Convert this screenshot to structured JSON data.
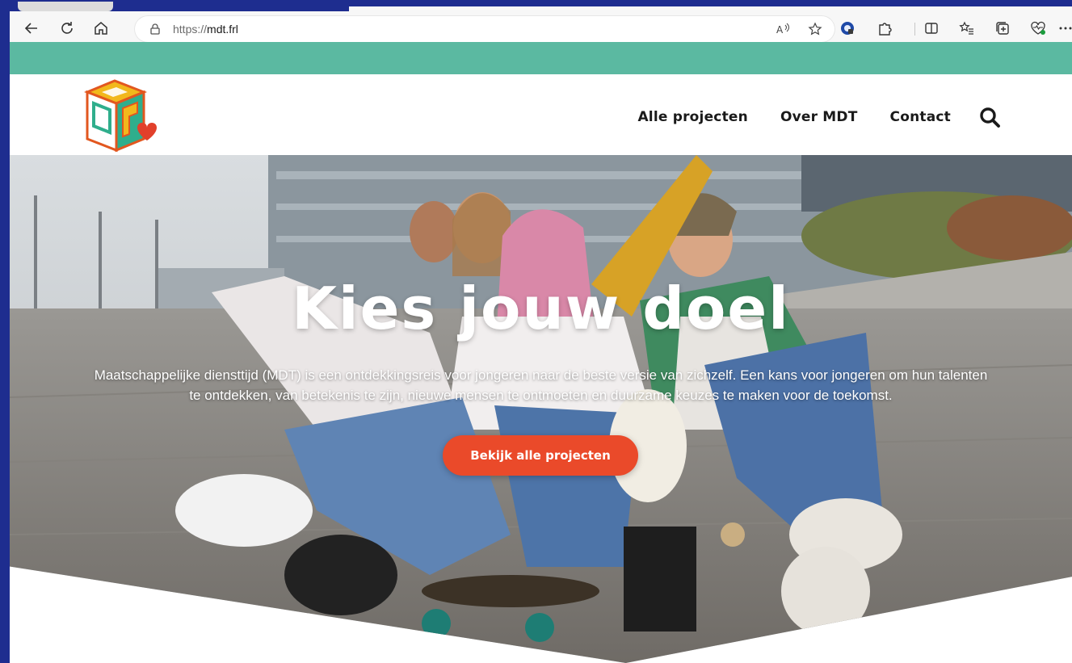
{
  "browser": {
    "url_scheme": "https://",
    "url_host": "mdt.frl",
    "icons": {
      "back": "arrow-left-icon",
      "reload": "refresh-icon",
      "home": "home-icon",
      "lock": "lock-icon",
      "read_aloud": "read-aloud-icon",
      "favorite": "star-icon",
      "tools": [
        "extension-shield-icon",
        "puzzle-icon",
        "split-screen-icon",
        "favorites-list-icon",
        "collections-icon",
        "heart-pulse-icon",
        "more-icon"
      ]
    }
  },
  "header": {
    "band_color": "#5bb9a1",
    "nav": [
      {
        "label": "Alle projecten"
      },
      {
        "label": "Over MDT"
      },
      {
        "label": "Contact"
      }
    ],
    "search_icon": "search-icon"
  },
  "hero": {
    "title": "Kies jouw doel",
    "text": "Maatschappelijke diensttijd (MDT) is een ontdekkingsreis voor jongeren naar de beste versie van zichzelf. Een kans voor jongeren om hun talenten te ontdekken, van betekenis te zijn, nieuwe mensen te ontmoeten en duurzame keuzes te maken voor de toekomst.",
    "cta_label": "Bekijk alle projecten",
    "cta_color": "#ea4a2a"
  }
}
